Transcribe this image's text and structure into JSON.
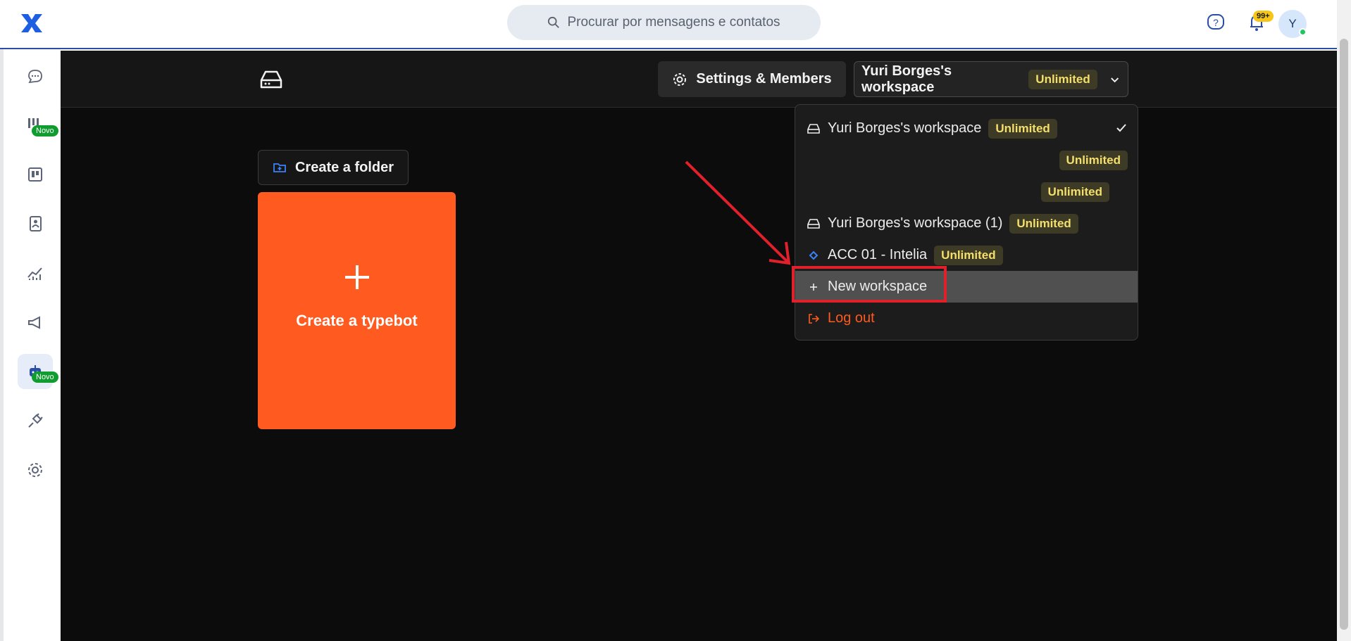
{
  "topbar": {
    "search_placeholder": "Procurar por mensagens e contatos",
    "notification_badge": "99+",
    "avatar_initial": "Y"
  },
  "sidebar": {
    "items": [
      {
        "icon": "chat-icon",
        "label": "Conversas"
      },
      {
        "icon": "kanban-icon",
        "badge": "Novo"
      },
      {
        "icon": "board-icon"
      },
      {
        "icon": "contacts-icon"
      },
      {
        "icon": "reports-icon"
      },
      {
        "icon": "campaigns-icon"
      },
      {
        "icon": "bot-icon",
        "badge": "Novo",
        "active": true
      },
      {
        "icon": "integrations-icon"
      },
      {
        "icon": "settings-icon"
      }
    ],
    "badge_label": "Novo"
  },
  "header": {
    "settings_label": "Settings & Members",
    "workspace_name": "Yuri Borges's workspace",
    "plan_label": "Unlimited"
  },
  "content": {
    "create_folder_label": "Create a folder",
    "create_typebot_label": "Create a typebot"
  },
  "menu": {
    "workspaces": [
      {
        "name": "Yuri Borges's workspace",
        "plan": "Unlimited",
        "selected": true
      },
      {
        "name": "",
        "plan": "Unlimited"
      },
      {
        "name": "",
        "plan": "Unlimited"
      },
      {
        "name": "Yuri Borges's workspace (1)",
        "plan": "Unlimited"
      },
      {
        "name": "ACC 01 - Intelia",
        "plan": "Unlimited"
      }
    ],
    "new_workspace_label": "New workspace",
    "logout_label": "Log out"
  },
  "colors": {
    "accent": "#ff5a1f",
    "plan_text": "#f4df6b",
    "annotation": "#e0202a"
  }
}
